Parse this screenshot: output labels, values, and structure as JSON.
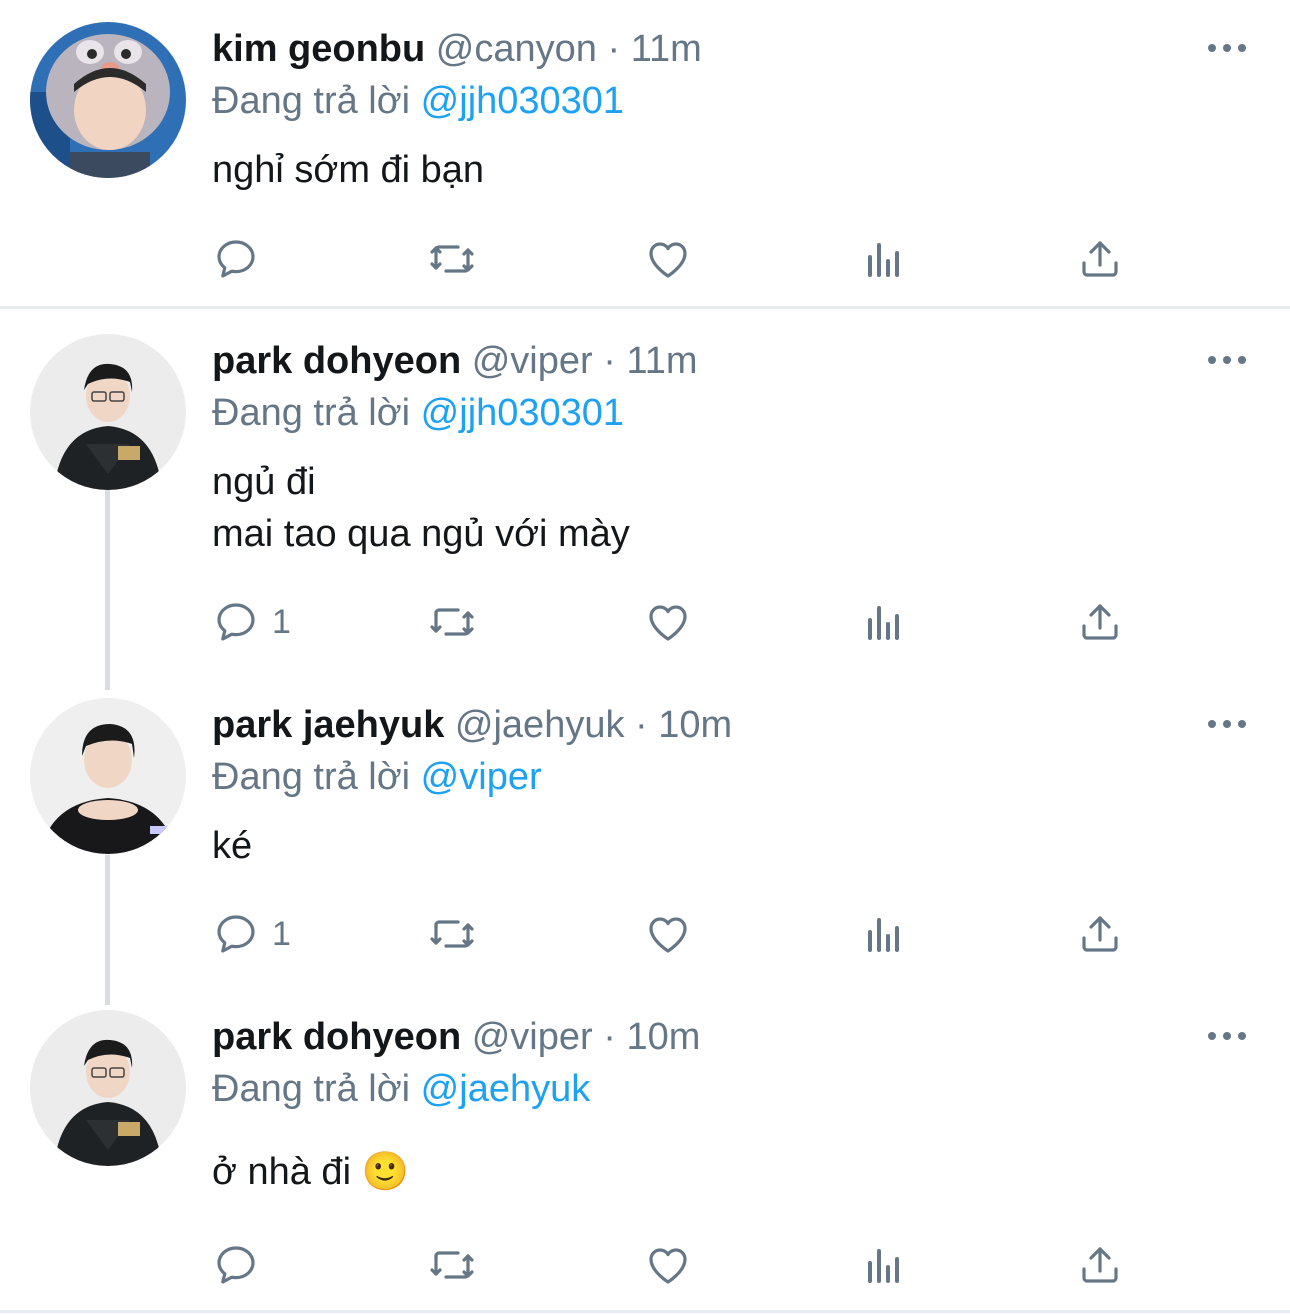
{
  "tweets": [
    {
      "name": "kim geonbu",
      "handle": "@canyon",
      "separator": "·",
      "time": "11m",
      "replying_prefix": "Đang trả lời",
      "replying_to": "@jjh030301",
      "lines": [
        "nghỉ sớm đi bạn"
      ],
      "reply_count": "",
      "avatar": "avatar-photo"
    },
    {
      "name": "park dohyeon",
      "handle": "@viper",
      "separator": "·",
      "time": "11m",
      "replying_prefix": "Đang trả lời",
      "replying_to": "@jjh030301",
      "lines": [
        "ngủ đi",
        "mai tao qua ngủ với mày"
      ],
      "reply_count": "1",
      "avatar": "avatar-photo"
    },
    {
      "name": "park jaehyuk",
      "handle": "@jaehyuk",
      "separator": "·",
      "time": "10m",
      "replying_prefix": "Đang trả lời",
      "replying_to": "@viper",
      "lines": [
        "ké"
      ],
      "reply_count": "1",
      "avatar": "avatar-photo"
    },
    {
      "name": "park dohyeon",
      "handle": "@viper",
      "separator": "·",
      "time": "10m",
      "replying_prefix": "Đang trả lời",
      "replying_to": "@jaehyuk",
      "lines": [
        "ở nhà đi 🙂"
      ],
      "reply_count": "",
      "avatar": "avatar-photo"
    }
  ],
  "icons": {
    "reply": "reply-icon",
    "retweet": "retweet-icon",
    "like": "like-icon",
    "analytics": "analytics-icon",
    "share": "share-icon",
    "more": "more-icon"
  },
  "colors": {
    "mention": "#1da1f2",
    "secondary_text": "#657786",
    "primary_text": "#14171a",
    "thread_line": "#d7dde2",
    "divider": "#e6ecf0"
  }
}
